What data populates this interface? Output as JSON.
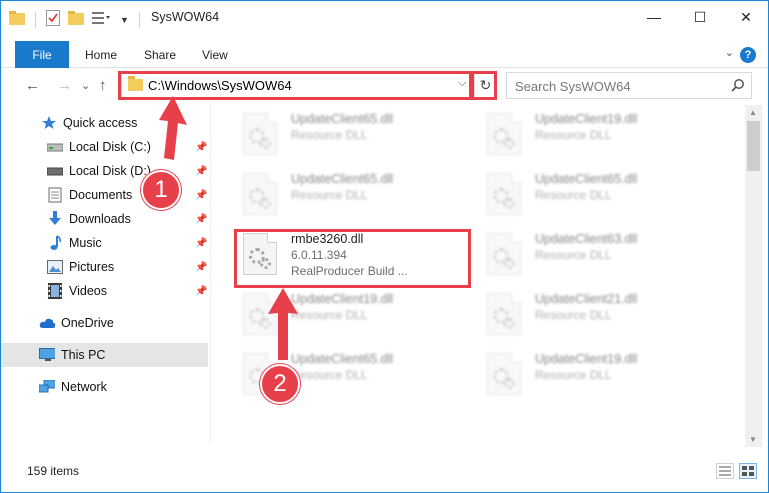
{
  "window": {
    "title": "SysWOW64",
    "minimize_glyph": "—",
    "maximize_glyph": "☐",
    "close_glyph": "✕"
  },
  "ribbon": {
    "file": "File",
    "tabs": [
      "Home",
      "Share",
      "View"
    ],
    "help": "?"
  },
  "address": {
    "path": "C:\\Windows\\SysWOW64",
    "dropdown_glyph": "⌵",
    "refresh_glyph": "↻"
  },
  "search": {
    "placeholder": "Search SysWOW64"
  },
  "nav": {
    "back": "←",
    "forward": "→",
    "recent": "⌄",
    "up": "↑",
    "items": [
      {
        "label": "Quick access",
        "icon": "star-icon"
      },
      {
        "label": "Local Disk (C:)",
        "icon": "drive-icon",
        "pinned": true
      },
      {
        "label": "Local Disk (D:)",
        "icon": "drive-icon",
        "pinned": true
      },
      {
        "label": "Documents",
        "icon": "documents-icon",
        "pinned": true
      },
      {
        "label": "Downloads",
        "icon": "downloads-icon",
        "pinned": true
      },
      {
        "label": "Music",
        "icon": "music-icon",
        "pinned": true
      },
      {
        "label": "Pictures",
        "icon": "pictures-icon",
        "pinned": true
      },
      {
        "label": "Videos",
        "icon": "videos-icon",
        "pinned": true
      },
      {
        "label": "OneDrive",
        "icon": "cloud-icon"
      },
      {
        "label": "This PC",
        "icon": "computer-icon",
        "selected": true
      },
      {
        "label": "Network",
        "icon": "network-icon"
      }
    ]
  },
  "files": [
    {
      "name": "UpdateClient65.dll",
      "type": "Resource DLL"
    },
    {
      "name": "UpdateClient19.dll",
      "type": "Resource DLL"
    },
    {
      "name": "UpdateClient65.dll",
      "type": "Resource DLL"
    },
    {
      "name": "UpdateClient65.dll",
      "type": "Resource DLL"
    },
    {
      "name": "rmbe3260.dll",
      "version": "6.0.11.394",
      "description": "RealProducer Build ..."
    },
    {
      "name": "UpdateClient63.dll",
      "type": "Resource DLL"
    },
    {
      "name": "UpdateClient19.dll",
      "type": "Resource DLL"
    },
    {
      "name": "UpdateClient21.dll",
      "type": "Resource DLL"
    },
    {
      "name": "UpdateClient65.dll",
      "type": "Resource DLL"
    },
    {
      "name": "UpdateClient19.dll",
      "type": "Resource DLL"
    }
  ],
  "status": {
    "item_count": "159 items"
  },
  "callouts": {
    "step1": "1",
    "step2": "2",
    "color": "#e8404a"
  }
}
